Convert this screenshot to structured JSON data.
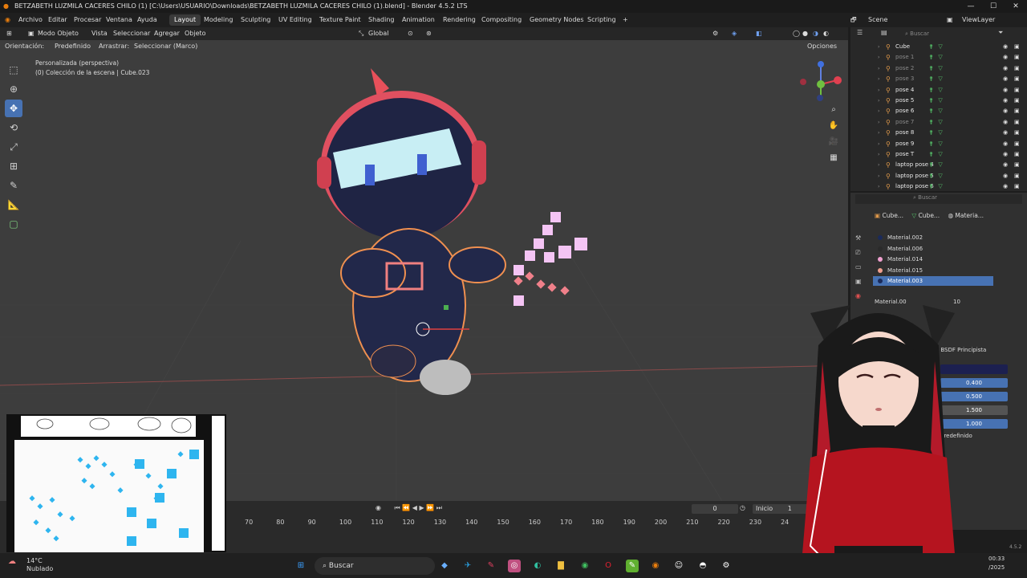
{
  "window": {
    "title": "BETZABETH LUZMILA CACERES CHILO (1) [C:\\Users\\USUARIO\\Downloads\\BETZABETH LUZMILA CACERES CHILO (1).blend] - Blender 4.5.2 LTS",
    "min": "—",
    "max": "☐",
    "close": "✕"
  },
  "menu": {
    "items": [
      "Archivo",
      "Editar",
      "Procesar",
      "Ventana",
      "Ayuda"
    ],
    "workspaces": [
      "Layout",
      "Modeling",
      "Sculpting",
      "UV Editing",
      "Texture Paint",
      "Shading",
      "Animation",
      "Rendering",
      "Compositing",
      "Geometry Nodes",
      "Scripting"
    ],
    "add": "+",
    "scene": "Scene",
    "view_layer": "ViewLayer"
  },
  "viewport_header": {
    "mode": "Modo Objeto",
    "menus": [
      "Vista",
      "Seleccionar",
      "Agregar",
      "Objeto"
    ],
    "transform": "Global"
  },
  "viewport_sub": {
    "orientation_label": "Orientación:",
    "orientation": "Predefinido",
    "drag_label": "Arrastrar:",
    "drag": "Seleccionar (Marco)",
    "options": "Opciones"
  },
  "overlay": {
    "line1": "Personalizada (perspectiva)",
    "line2": "(0) Colección de la escena | Cube.023"
  },
  "gizmo": {
    "x": "X",
    "y": "Y",
    "z": "Z"
  },
  "outliner": {
    "search_placeholder": "Buscar",
    "rows": [
      {
        "name": "Cube",
        "dim": false
      },
      {
        "name": "pose 1",
        "dim": true
      },
      {
        "name": "pose 2",
        "dim": true
      },
      {
        "name": "pose 3",
        "dim": true
      },
      {
        "name": "pose 4",
        "dim": false
      },
      {
        "name": "pose 5",
        "dim": false
      },
      {
        "name": "pose 6",
        "dim": false
      },
      {
        "name": "pose 7",
        "dim": true
      },
      {
        "name": "pose 8",
        "dim": false
      },
      {
        "name": "pose 9",
        "dim": false
      },
      {
        "name": "pose T",
        "dim": false
      },
      {
        "name": "laptop pose 4",
        "dim": false
      },
      {
        "name": "laptop pose 5",
        "dim": false
      },
      {
        "name": "laptop pose 6",
        "dim": false
      }
    ]
  },
  "properties": {
    "search_placeholder": "Buscar",
    "breadcrumb": [
      "Cube...",
      "Cube...",
      "Materia..."
    ],
    "materials": [
      {
        "name": "Material.002",
        "color": "#1a2a5a",
        "selected": false
      },
      {
        "name": "Material.006",
        "color": "#2a2a2a",
        "selected": false
      },
      {
        "name": "Material.014",
        "color": "#f0a0d0",
        "selected": false
      },
      {
        "name": "Material.015",
        "color": "#f0a090",
        "selected": false
      },
      {
        "name": "Material.003",
        "color": "#1a2a5a",
        "selected": true
      }
    ],
    "material_field": "Material.00",
    "users": "10",
    "shader": "BSDF Principista",
    "values": [
      "0.400",
      "0.500",
      "1.500",
      "1.000"
    ],
    "preset": "Predefinido"
  },
  "timeline": {
    "frame": "0",
    "start_label": "Inicio",
    "start": "1",
    "ticks": [
      "70",
      "80",
      "90",
      "100",
      "110",
      "120",
      "130",
      "140",
      "150",
      "160",
      "170",
      "180",
      "190",
      "200",
      "210",
      "220",
      "230",
      "24"
    ]
  },
  "taskbar": {
    "weather_temp": "14°C",
    "weather_desc": "Nublado",
    "search": "Buscar",
    "time": "00:33",
    "date": "/2025",
    "version": "4.5.2"
  }
}
